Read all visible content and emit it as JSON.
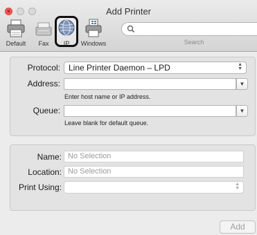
{
  "window": {
    "title": "Add Printer"
  },
  "toolbar": {
    "items": [
      {
        "label": "Default",
        "icon": "printer-default-icon"
      },
      {
        "label": "Fax",
        "icon": "fax-icon"
      },
      {
        "label": "IP",
        "icon": "globe-icon"
      },
      {
        "label": "Windows",
        "icon": "windows-printer-icon"
      }
    ],
    "search_label": "Search",
    "search_icon": "magnifier-icon"
  },
  "connection": {
    "protocol_label": "Protocol:",
    "protocol_value": "Line Printer Daemon – LPD",
    "address_label": "Address:",
    "address_value": "",
    "address_hint": "Enter host name or IP address.",
    "queue_label": "Queue:",
    "queue_value": "",
    "queue_hint": "Leave blank for default queue."
  },
  "details": {
    "name_label": "Name:",
    "name_value": "No Selection",
    "location_label": "Location:",
    "location_value": "No Selection",
    "print_using_label": "Print Using:",
    "print_using_value": ""
  },
  "actions": {
    "add_label": "Add"
  },
  "colors": {
    "close_button": "#f25b57",
    "highlight_border": "#111111",
    "disabled_text": "#9e9e9e"
  }
}
